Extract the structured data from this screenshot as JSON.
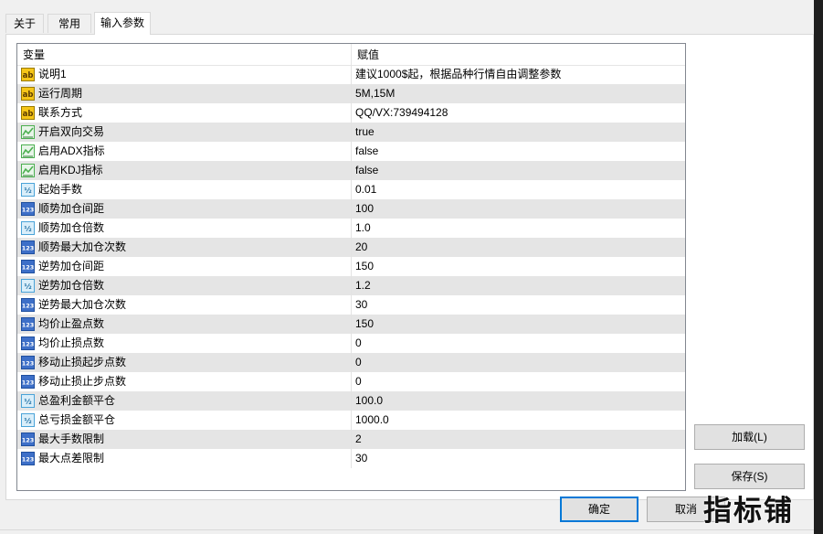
{
  "tabs": [
    {
      "label": "关于"
    },
    {
      "label": "常用"
    },
    {
      "label": "输入参数"
    }
  ],
  "active_tab": "输入参数",
  "grid": {
    "headers": {
      "variable": "变量",
      "value": "赋值"
    },
    "rows": [
      {
        "type": "string",
        "name": "说明1",
        "value": "建议1000$起，根据品种行情自由调整参数"
      },
      {
        "type": "string",
        "name": "运行周期",
        "value": "5M,15M"
      },
      {
        "type": "string",
        "name": "联系方式",
        "value": "QQ/VX:739494128"
      },
      {
        "type": "bool",
        "name": "开启双向交易",
        "value": "true"
      },
      {
        "type": "bool",
        "name": "启用ADX指标",
        "value": "false"
      },
      {
        "type": "bool",
        "name": "启用KDJ指标",
        "value": "false"
      },
      {
        "type": "double",
        "name": "起始手数",
        "value": "0.01"
      },
      {
        "type": "int",
        "name": "顺势加仓间距",
        "value": "100"
      },
      {
        "type": "double",
        "name": "顺势加仓倍数",
        "value": "1.0"
      },
      {
        "type": "int",
        "name": "顺势最大加仓次数",
        "value": "20"
      },
      {
        "type": "int",
        "name": "逆势加仓间距",
        "value": "150"
      },
      {
        "type": "double",
        "name": "逆势加仓倍数",
        "value": "1.2"
      },
      {
        "type": "int",
        "name": "逆势最大加仓次数",
        "value": "30"
      },
      {
        "type": "int",
        "name": "均价止盈点数",
        "value": "150"
      },
      {
        "type": "int",
        "name": "均价止损点数",
        "value": "0"
      },
      {
        "type": "int",
        "name": "移动止损起步点数",
        "value": "0"
      },
      {
        "type": "int",
        "name": "移动止损止步点数",
        "value": "0"
      },
      {
        "type": "double",
        "name": "总盈利金额平仓",
        "value": "100.0"
      },
      {
        "type": "double",
        "name": "总亏损金额平仓",
        "value": "1000.0"
      },
      {
        "type": "int",
        "name": "最大手数限制",
        "value": "2"
      },
      {
        "type": "int",
        "name": "最大点差限制",
        "value": "30"
      }
    ]
  },
  "buttons": {
    "load": "加载(L)",
    "save": "保存(S)",
    "ok": "确定",
    "cancel": "取消"
  },
  "watermark": "指标铺",
  "icons": {
    "string": "ab-string-icon",
    "bool": "bool-chart-icon",
    "double": "fraction-double-icon",
    "int": "123-integer-icon"
  },
  "colors": {
    "default_button_border": "#0078d7",
    "alt_row": "#e5e5e5",
    "string_icon": "#f5c518",
    "bool_icon": "#4caf50",
    "int_icon": "#3d6fc8",
    "double_icon": "#4aa3d8"
  }
}
